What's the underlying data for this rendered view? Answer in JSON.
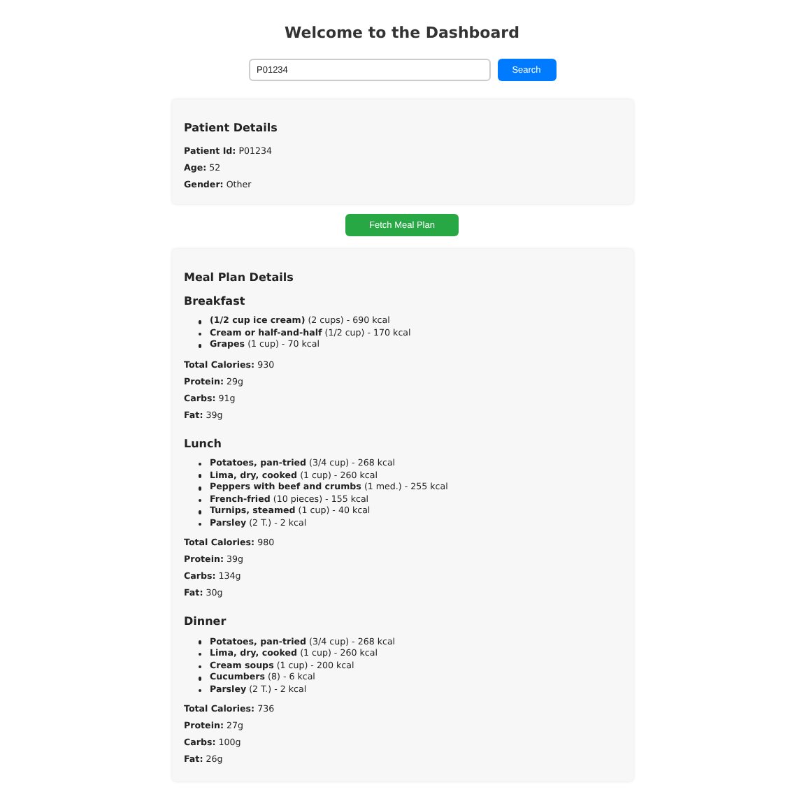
{
  "title": "Welcome to the Dashboard",
  "search": {
    "value": "P01234",
    "button": "Search"
  },
  "patient": {
    "heading": "Patient Details",
    "fields": [
      "**Patient Id:** P01234",
      "**Age:** 52",
      "**Gender:** Other"
    ]
  },
  "fetch_button": "Fetch Meal Plan",
  "meal_plan": {
    "heading": "Meal Plan Details",
    "meals": [
      {
        "name": "Breakfast",
        "items": [
          "**(1/2 cup ice cream)** (2 cups) - 690 kcal",
          "**Cream or half-and-half** (1/2 cup) - 170 kcal",
          "**Grapes** (1 cup) - 70 kcal"
        ],
        "totals": [
          "**Total Calories:** 930",
          "**Protein:** 29g",
          "**Carbs:** 91g",
          "**Fat:** 39g"
        ]
      },
      {
        "name": "Lunch",
        "items": [
          "**Potatoes, pan-tried** (3/4 cup) - 268 kcal",
          "**Lima, dry, cooked** (1 cup) - 260 kcal",
          "**Peppers with beef and crumbs** (1 med.) - 255 kcal",
          "**French-fried** (10 pieces) - 155 kcal",
          "**Turnips, steamed** (1 cup) - 40 kcal",
          "**Parsley** (2 T.) - 2 kcal"
        ],
        "totals": [
          "**Total Calories:** 980",
          "**Protein:** 39g",
          "**Carbs:** 134g",
          "**Fat:** 30g"
        ]
      },
      {
        "name": "Dinner",
        "items": [
          "**Potatoes, pan-tried** (3/4 cup) - 268 kcal",
          "**Lima, dry, cooked** (1 cup) - 260 kcal",
          "**Cream soups** (1 cup) - 200 kcal",
          "**Cucumbers** (8) - 6 kcal",
          "**Parsley** (2 T.) - 2 kcal"
        ],
        "totals": [
          "**Total Calories:** 736",
          "**Protein:** 27g",
          "**Carbs:** 100g",
          "**Fat:** 26g"
        ]
      }
    ]
  }
}
